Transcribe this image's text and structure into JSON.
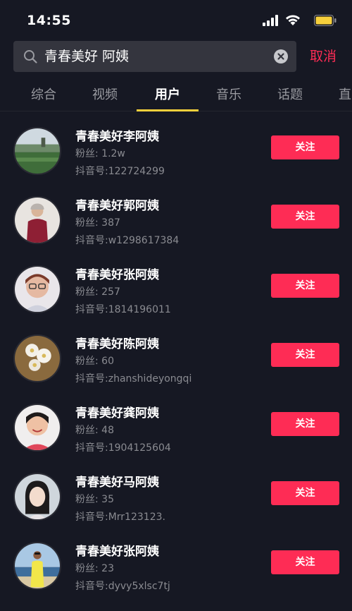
{
  "status_bar": {
    "time": "14:55",
    "icons": [
      "signal-icon",
      "wifi-icon",
      "battery-icon"
    ],
    "battery_color": "#f7d03c"
  },
  "search": {
    "query": "青春美好 阿姨",
    "cancel_label": "取消"
  },
  "tabs": [
    {
      "label": "综合"
    },
    {
      "label": "视频"
    },
    {
      "label": "用户"
    },
    {
      "label": "音乐"
    },
    {
      "label": "话题"
    },
    {
      "label": "直"
    }
  ],
  "active_tab": "用户",
  "colors": {
    "accent": "#fe2c55",
    "tab_indicator": "#f7d03c",
    "background": "#161823"
  },
  "users": [
    {
      "name": "青春美好李阿姨",
      "fans": "粉丝: 1.2w",
      "id": "抖音号:122724299",
      "follow_label": "关注",
      "avatar": "landscape-avatar"
    },
    {
      "name": "青春美好郭阿姨",
      "fans": "粉丝: 387",
      "id": "抖音号:w1298617384",
      "follow_label": "关注",
      "avatar": "woman-red-coat-avatar"
    },
    {
      "name": "青春美好张阿姨",
      "fans": "粉丝: 257",
      "id": "抖音号:1814196011",
      "follow_label": "关注",
      "avatar": "woman-glasses-avatar"
    },
    {
      "name": "青春美好陈阿姨",
      "fans": "粉丝: 60",
      "id": "抖音号:zhanshideyongqi",
      "follow_label": "关注",
      "avatar": "flowers-avatar"
    },
    {
      "name": "青春美好龚阿姨",
      "fans": "粉丝: 48",
      "id": "抖音号:1904125604",
      "follow_label": "关注",
      "avatar": "woman-smiling-avatar"
    },
    {
      "name": "青春美好马阿姨",
      "fans": "粉丝: 35",
      "id": "抖音号:Mrr123123.",
      "follow_label": "关注",
      "avatar": "girl-portrait-avatar"
    },
    {
      "name": "青春美好张阿姨",
      "fans": "粉丝: 23",
      "id": "抖音号:dyvy5xlsc7tj",
      "follow_label": "关注",
      "avatar": "beach-person-avatar"
    }
  ]
}
